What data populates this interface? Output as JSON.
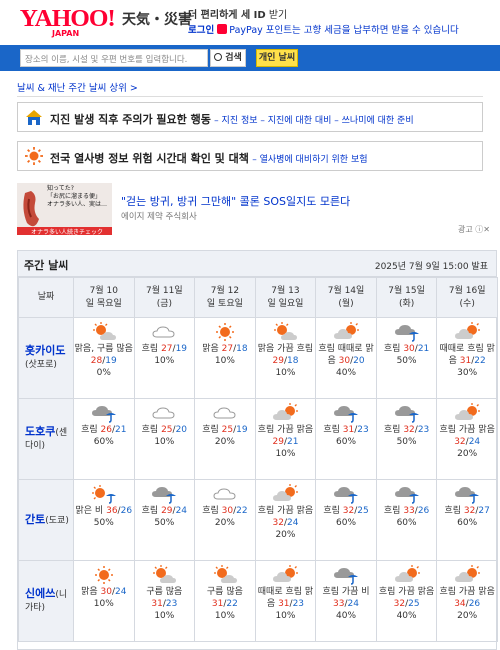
{
  "header": {
    "logo_main": "YAHOO!",
    "logo_sub": "JAPAN",
    "service_name": "天気・災害",
    "line1_bold": "더 편리하게 세 ID",
    "line1_rest": "받기",
    "login_label": "로그인",
    "paypay_text": "PayPay 포인트는 고향 세금을 납부하면 받을 수 있습니다"
  },
  "search": {
    "placeholder": "장소의 이름, 시설 및 우편 번호를 입력합니다.",
    "search_button": "검색",
    "my_button": "개인 날씨"
  },
  "breadcrumb": "날씨 & 재난 주간 날씨 상위 >",
  "banners": [
    {
      "title": "지진 발생 직후 주의가 필요한 행동",
      "sub": "– 지진 정보 – 지진에 대한 대비 – 쓰나미에 대한 준비"
    },
    {
      "title": "전국 열사병 정보 위험 시간대 확인 및 대책",
      "sub": "– 열사병에 대비하기 위한 보험"
    }
  ],
  "ad": {
    "title": "\"걷는 방귀, 방귀 그만해\" 콜론 SOS일지도 모른다",
    "advertiser": "에이지 제약 주식회사",
    "image_text_1": "知ってた?",
    "image_text_2": "「お尻に溜まる便」",
    "image_text_3": "オナラ多い人、実は…",
    "image_cta": "オナラ多い人続きチェック",
    "tag": "광고"
  },
  "weekly": {
    "title": "주간 날씨",
    "issued": "2025년 7월 9일 15:00 발표",
    "corner": "날짜",
    "days": [
      {
        "l1": "7월 10",
        "l2": "일 목요일"
      },
      {
        "l1": "7월 11일",
        "l2": "(금)"
      },
      {
        "l1": "7월 12",
        "l2": "일 토요일"
      },
      {
        "l1": "7월 13",
        "l2": "일 일요일"
      },
      {
        "l1": "7월 14일",
        "l2": "(월)"
      },
      {
        "l1": "7월 15일",
        "l2": "(화)"
      },
      {
        "l1": "7월 16일",
        "l2": "(수)"
      }
    ],
    "regions": [
      {
        "name": "홋카이도",
        "sub": "(삿포로)",
        "cells": [
          {
            "icon": "sun-cloud-icon",
            "text": "맑음, 구름 많음",
            "hi": "28",
            "lo": "19",
            "pop": "0%"
          },
          {
            "icon": "cloud-icon",
            "text": "흐림",
            "hi": "27",
            "lo": "19",
            "pop": "10%"
          },
          {
            "icon": "sun-icon",
            "text": "맑음",
            "hi": "27",
            "lo": "18",
            "pop": "10%"
          },
          {
            "icon": "sun-cloud-icon",
            "text": "맑음 가끔 흐림",
            "hi": "29",
            "lo": "18",
            "pop": "10%"
          },
          {
            "icon": "cloud-sun-icon",
            "text": "흐림 때때로 맑음",
            "hi": "30",
            "lo": "20",
            "pop": "40%"
          },
          {
            "icon": "cloud-rain-icon",
            "text": "흐림",
            "hi": "30",
            "lo": "21",
            "pop": "50%"
          },
          {
            "icon": "cloud-sun-icon",
            "text": "때때로 흐림 맑음",
            "hi": "31",
            "lo": "22",
            "pop": "30%"
          }
        ]
      },
      {
        "name": "도호쿠",
        "sub": "(센다이)",
        "cells": [
          {
            "icon": "cloud-rain-icon",
            "text": "흐림",
            "hi": "26",
            "lo": "21",
            "pop": "60%"
          },
          {
            "icon": "cloud-icon",
            "text": "흐림",
            "hi": "25",
            "lo": "20",
            "pop": "10%"
          },
          {
            "icon": "cloud-icon",
            "text": "흐림",
            "hi": "25",
            "lo": "19",
            "pop": "20%"
          },
          {
            "icon": "cloud-sun-icon",
            "text": "흐림 가끔 맑음",
            "hi": "29",
            "lo": "21",
            "pop": "10%"
          },
          {
            "icon": "cloud-rain-icon",
            "text": "흐림",
            "hi": "31",
            "lo": "23",
            "pop": "60%"
          },
          {
            "icon": "cloud-rain-icon",
            "text": "흐림",
            "hi": "32",
            "lo": "23",
            "pop": "50%"
          },
          {
            "icon": "cloud-sun-icon",
            "text": "흐림 가끔 맑음",
            "hi": "32",
            "lo": "24",
            "pop": "20%"
          }
        ]
      },
      {
        "name": "간토",
        "sub": "(도쿄)",
        "cells": [
          {
            "icon": "sun-rain-icon",
            "text": "맑은 비",
            "hi": "36",
            "lo": "26",
            "pop": "50%"
          },
          {
            "icon": "cloud-rain-icon",
            "text": "흐림",
            "hi": "29",
            "lo": "24",
            "pop": "50%"
          },
          {
            "icon": "cloud-icon",
            "text": "흐림",
            "hi": "30",
            "lo": "22",
            "pop": "20%"
          },
          {
            "icon": "cloud-sun-icon",
            "text": "흐림 가끔 맑음",
            "hi": "32",
            "lo": "24",
            "pop": "20%"
          },
          {
            "icon": "cloud-rain-icon",
            "text": "흐림",
            "hi": "32",
            "lo": "25",
            "pop": "60%"
          },
          {
            "icon": "cloud-rain-icon",
            "text": "흐림",
            "hi": "33",
            "lo": "26",
            "pop": "60%"
          },
          {
            "icon": "cloud-rain-icon",
            "text": "흐림",
            "hi": "32",
            "lo": "27",
            "pop": "60%"
          }
        ]
      },
      {
        "name": "신에쓰",
        "sub": "(니가타)",
        "cells": [
          {
            "icon": "sun-icon",
            "text": "맑음",
            "hi": "30",
            "lo": "24",
            "pop": "10%"
          },
          {
            "icon": "sun-cloud-icon",
            "text": "구름 많음",
            "hi": "31",
            "lo": "23",
            "pop": "10%"
          },
          {
            "icon": "sun-cloud-icon",
            "text": "구름 많음",
            "hi": "31",
            "lo": "22",
            "pop": "10%"
          },
          {
            "icon": "cloud-sun-icon",
            "text": "때때로 흐림 맑음",
            "hi": "31",
            "lo": "23",
            "pop": "10%"
          },
          {
            "icon": "cloud-rain-icon",
            "text": "흐림 가끔 비",
            "hi": "33",
            "lo": "24",
            "pop": "40%"
          },
          {
            "icon": "cloud-sun-icon",
            "text": "흐림 가끔 맑음",
            "hi": "32",
            "lo": "25",
            "pop": "40%"
          },
          {
            "icon": "cloud-sun-icon",
            "text": "흐림 가끔 맑음",
            "hi": "34",
            "lo": "26",
            "pop": "20%"
          }
        ]
      }
    ]
  },
  "colors": {
    "brand_red": "#ff0033",
    "link_blue": "#0033cc",
    "search_bar": "#1a66c8",
    "hi_temp": "#e0301e",
    "lo_temp": "#1a66c8"
  }
}
